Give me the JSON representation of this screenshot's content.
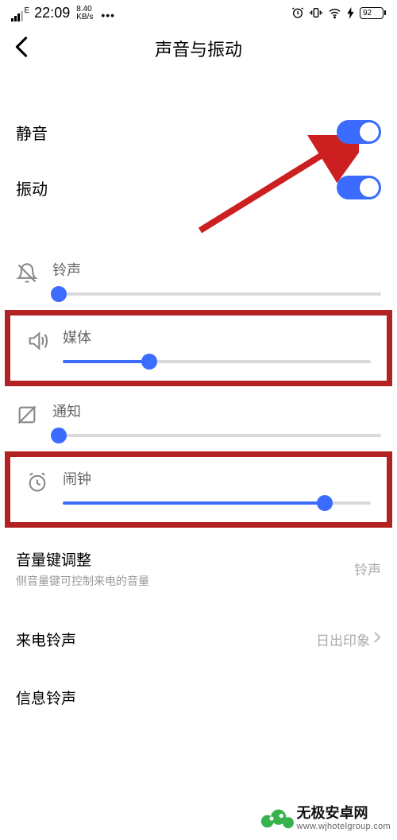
{
  "status": {
    "net_type": "E",
    "time": "22:09",
    "kbs_top": "8.40",
    "kbs_bottom": "KB/s",
    "dots": "•••",
    "battery_text": "92"
  },
  "header": {
    "title": "声音与振动"
  },
  "toggles": {
    "silent": {
      "label": "静音",
      "on": true
    },
    "vibrate": {
      "label": "振动",
      "on": true
    }
  },
  "sliders": {
    "ringtone": {
      "label": "铃声",
      "percent": 2
    },
    "media": {
      "label": "媒体",
      "percent": 28
    },
    "notify": {
      "label": "通知",
      "percent": 2
    },
    "alarm": {
      "label": "闹钟",
      "percent": 85
    }
  },
  "menu": {
    "volume_key": {
      "title": "音量键调整",
      "sub": "侧音量键可控制来电的音量",
      "value": "铃声"
    },
    "incoming": {
      "title": "来电铃声",
      "value": "日出印象"
    },
    "sms": {
      "title": "信息铃声"
    }
  },
  "watermark": {
    "name": "无极安卓网",
    "url": "www.wjhotelgroup.com"
  }
}
